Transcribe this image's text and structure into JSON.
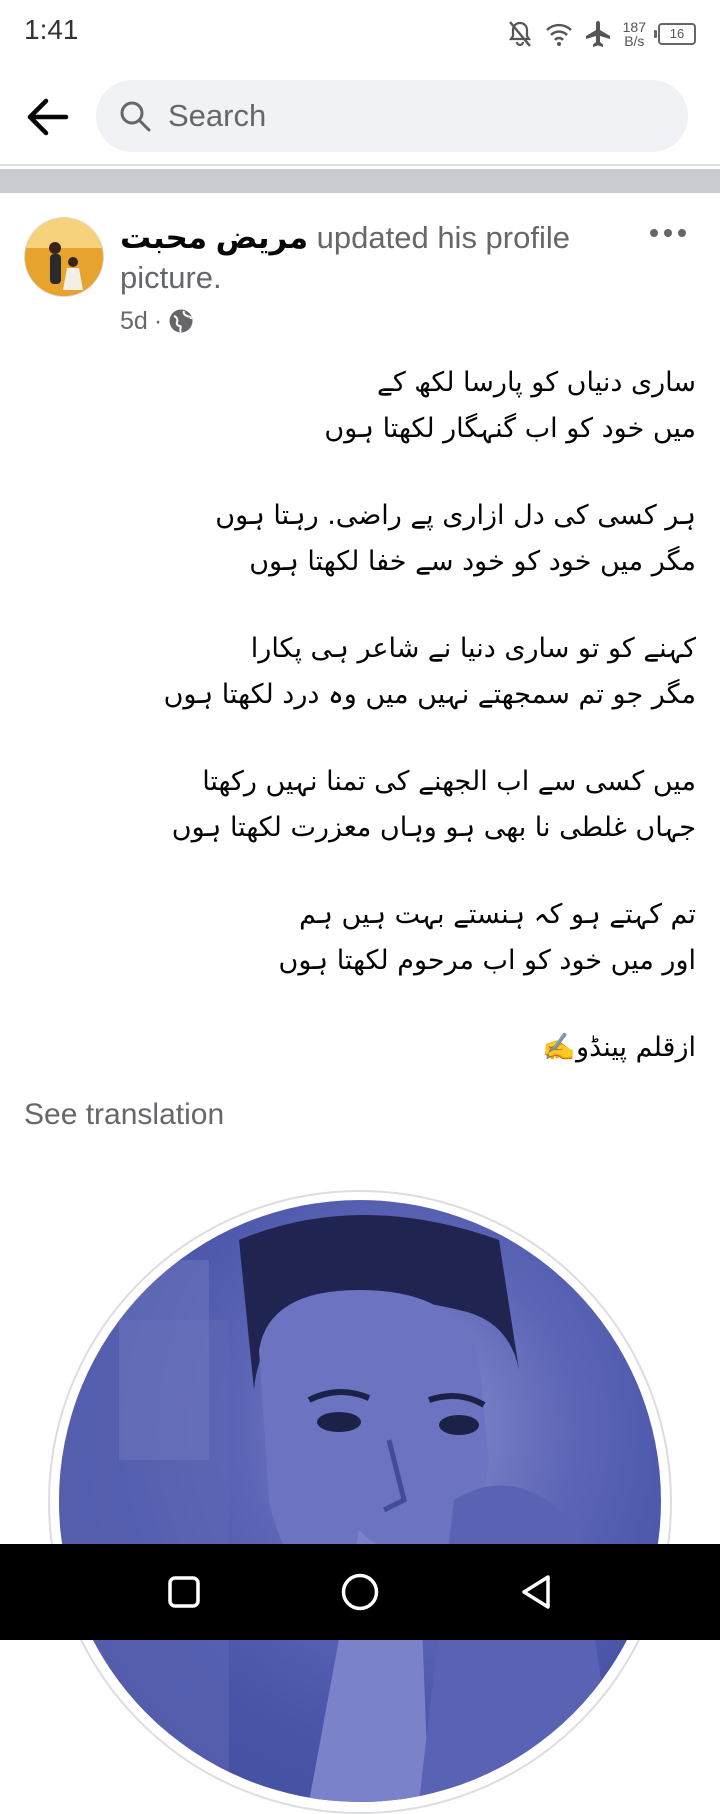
{
  "status_bar": {
    "time": "1:41",
    "net_speed_value": "187",
    "net_speed_unit": "B/s",
    "battery": "16",
    "icons": [
      "mute-icon",
      "wifi-icon",
      "airplane-icon",
      "battery-icon"
    ]
  },
  "search": {
    "placeholder": "Search"
  },
  "post": {
    "author": "مریض محبت",
    "action": " updated his profile picture.",
    "time": "5d",
    "audience_icon": "globe-icon",
    "stanzas": [
      {
        "lines": [
          "ساری دنیاں کو  پارسا  لکھ  کے",
          "میں  خود  کو  اب  گنہگار  لکھتا ہوں"
        ]
      },
      {
        "lines": [
          "ہر کسی کی دل ازاری پے راضی. رہتا ہوں",
          "مگر میں  خود  کو خود  سے  خفا لکھتا ہوں"
        ]
      },
      {
        "lines": [
          "کہنے کو تو  ساری  دنیا  نے شاعر  ہی  پکارا",
          "مگر جو تم سمجھتے نہیں میں وہ درد لکھتا ہوں"
        ]
      },
      {
        "lines": [
          "میں کسی سے اب الجھنے کی تمنا نہیں رکھتا",
          "جہاں غلطی  نا  بھی ہو وہاں معزرت  لکھتا ہوں"
        ]
      },
      {
        "lines": [
          "تم  کہتے ہو کہ ہنستے بہت ہیں ہم",
          "اور میں خود کو اب مرحوم لکھتا ہوں"
        ]
      }
    ],
    "signature": "ازقلم پینڈو✍️",
    "see_translation": "See translation"
  },
  "colors": {
    "secondary_text": "#65676b",
    "search_bg": "#f0f2f5",
    "photo_tint": "#4a55a8"
  }
}
